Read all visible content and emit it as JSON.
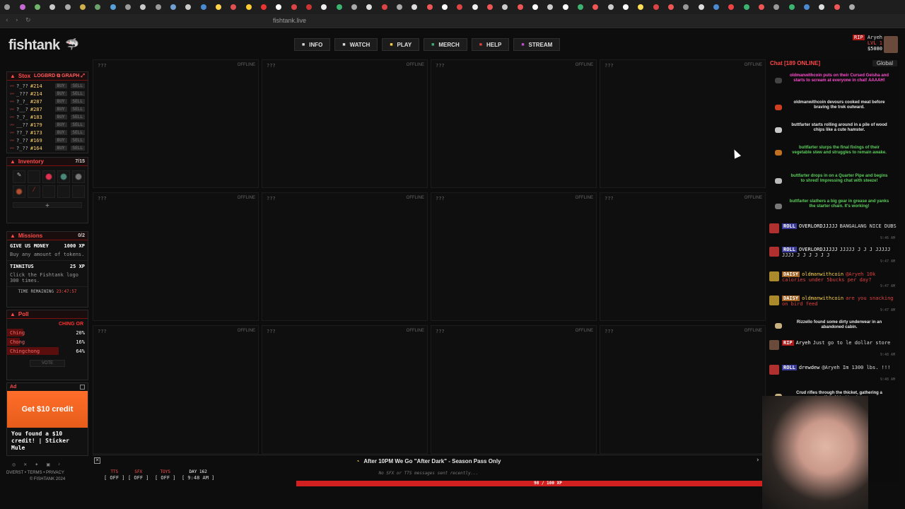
{
  "browser": {
    "url": "fishtank.live",
    "tab_colors": [
      "#9a9a9a",
      "#c36bd0",
      "#70b36b",
      "#c9c9c9",
      "#aaaaaa",
      "#d0b04a",
      "#6ea06b",
      "#57a0d6",
      "#9a9a9a",
      "#c9c9c9",
      "#999",
      "#70a0d0",
      "#c9c9c9",
      "#4a8ad0",
      "#ffd34a",
      "#e05050",
      "#ffcc33",
      "#e33",
      "#fff",
      "#d44",
      "#c33",
      "#eee",
      "#3cb371",
      "#aaa",
      "#ddd",
      "#d44",
      "#aaa",
      "#ddd",
      "#e55",
      "#fff",
      "#d44",
      "#eee",
      "#e55",
      "#ccc",
      "#e55",
      "#fff",
      "#ccc",
      "#fff",
      "#3cb371",
      "#e55",
      "#ccc",
      "#fff",
      "#ffdd55",
      "#d44",
      "#e55",
      "#999",
      "#ddd",
      "#4a8ad0",
      "#e44",
      "#3cb371",
      "#e55",
      "#999",
      "#3cb371",
      "#4a8ad0",
      "#ddd",
      "#e55",
      "#aaa"
    ]
  },
  "header": {
    "logo": "fishtank",
    "nav": [
      {
        "label": "INFO",
        "icon": "info-icon",
        "color": "#ddd"
      },
      {
        "label": "WATCH",
        "icon": "tv-icon",
        "color": "#ddd"
      },
      {
        "label": "PLAY",
        "icon": "grid-icon",
        "color": "#ffd34a"
      },
      {
        "label": "MERCH",
        "icon": "cart-icon",
        "color": "#3cb371"
      },
      {
        "label": "HELP",
        "icon": "help-icon",
        "color": "#e04040"
      },
      {
        "label": "STREAM",
        "icon": "stream-icon",
        "color": "#c050d0"
      }
    ],
    "user": {
      "badge": "RIP",
      "name": "Aryeh",
      "level": "LVL 1",
      "coins": "$5080"
    }
  },
  "stox": {
    "title": "Stox",
    "links": "LOGBRD ⧉ GRAPH ⤢",
    "rows": [
      {
        "name": "?_??",
        "price": "#214"
      },
      {
        "name": "_???",
        "price": "#214"
      },
      {
        "name": "?_?_",
        "price": "#287"
      },
      {
        "name": "?__?",
        "price": "#287"
      },
      {
        "name": "?_?_",
        "price": "#183"
      },
      {
        "name": "__??",
        "price": "#179"
      },
      {
        "name": "??_?",
        "price": "#173"
      },
      {
        "name": "?_??",
        "price": "#169"
      },
      {
        "name": "?_??",
        "price": "#164"
      }
    ],
    "buy": "BUY",
    "sell": "SELL"
  },
  "inventory": {
    "title": "Inventory",
    "count": "7/15",
    "add": "+"
  },
  "missions": {
    "title": "Missions",
    "count": "0/2",
    "items": [
      {
        "name": "GIVE US MONEY",
        "xp": "1000 XP",
        "desc": "Buy any amount of tokens."
      },
      {
        "name": "TINNITUS",
        "xp": "25 XP",
        "desc": "Click the Fishtank logo 300 times."
      }
    ],
    "timer_label": "TIME REMAINING",
    "timer": "23:47:57"
  },
  "poll": {
    "title": "Poll",
    "status": "CHING OR",
    "options": [
      {
        "label": "Ching",
        "pct": "20%"
      },
      {
        "label": "Chong",
        "pct": "16%"
      },
      {
        "label": "Chingchong",
        "pct": "64%"
      }
    ],
    "vote": "VOTE"
  },
  "ad": {
    "title": "Ad",
    "headline": "Get $10 credit",
    "body": "You found a $10 credit! | Sticker Mule"
  },
  "footer": {
    "links": "DVERST  •  TERMS  •  PRIVACY",
    "copy": "© FISHTANK 2024"
  },
  "cams": [
    {
      "name": "???",
      "status": "OFFLINE"
    },
    {
      "name": "???",
      "status": "OFFLINE"
    },
    {
      "name": "???",
      "status": "OFFLINE"
    },
    {
      "name": "???",
      "status": "OFFLINE"
    },
    {
      "name": "???",
      "status": "OFFLINE"
    },
    {
      "name": "???",
      "status": "OFFLINE"
    },
    {
      "name": "???",
      "status": "OFFLINE"
    },
    {
      "name": "???",
      "status": "OFFLINE"
    },
    {
      "name": "???",
      "status": "OFFLINE"
    },
    {
      "name": "???",
      "status": "OFFLINE"
    },
    {
      "name": "???",
      "status": "OFFLINE"
    },
    {
      "name": "???",
      "status": "OFFLINE"
    }
  ],
  "chat": {
    "title": "Chat [189 ONLINE]",
    "scope": "Global",
    "system": [
      {
        "text": "oldmanwithcoin puts on their Cursed Geisha and starts to scream at everyone in chat! AAAAH!",
        "color": "#ff4bd0"
      },
      {
        "text": "oldmanwithcoin devours cooked meat before braving the trek outward.",
        "color": "#eaeaea"
      },
      {
        "text": "buttfarter starts rolling around in a pile of wood chips like a cute hamster.",
        "color": "#eaeaea"
      },
      {
        "text": "buttfarter slurps the final fixings of their vegetable stew and struggles to remain awake.",
        "color": "#5bd05b"
      },
      {
        "text": "buttfarter drops in on a Quarter Pipe and begins to shred! Impressing chat with steeze!",
        "color": "#5bd05b"
      },
      {
        "text": "buttfarter slathers a big gear in grease and yanks the starter chain. It's working!",
        "color": "#5bd05b"
      }
    ],
    "messages": [
      {
        "badge": "ROLL",
        "user": "OVERLORDJJJJJ",
        "text": "BANGALANG NICE DUBS",
        "time": "9:46 AM"
      },
      {
        "badge": "ROLL",
        "user": "OVERLORDJJJJJ",
        "text": "JJJJJ J J J JJJJJ JJJJ J J J J J J",
        "time": "9:47 AM"
      },
      {
        "badge": "DAISY",
        "user": "oldmanwithcoin",
        "text": "@Aryeh 10k calories under 5bucks per day?",
        "time": "9:47 AM"
      },
      {
        "badge": "DAISY",
        "user": "oldmanwithcoin",
        "text": "are you snacking on bird feed",
        "time": "9:47 AM"
      },
      {
        "badge": "RIP",
        "user": "Aryeh",
        "text": "Just go to le dollar store",
        "time": "9:48 AM"
      },
      {
        "badge": "ROLL",
        "user": "drewdew",
        "text": "@Aryeh Im 1300 lbs. !!!",
        "time": "9:48 AM"
      }
    ],
    "system2": [
      {
        "text": "Rizzello found some dirty underwear in an abandoned cabin.",
        "color": "#eaeaea"
      },
      {
        "text": "Crud rifles through the thicket, gathering a handful of blackberries.",
        "color": "#eaeaea"
      }
    ]
  },
  "banner": "After 10PM We Go \"After Dark\" - Season Pass Only",
  "bottom": {
    "controls": [
      {
        "label": "TTS",
        "state": "[ OFF ]"
      },
      {
        "label": "SFX",
        "state": "[ OFF ]"
      },
      {
        "label": "TOYS",
        "state": "[ OFF ]"
      },
      {
        "label": "DAY 162",
        "state": "[ 9:48 AM ]"
      }
    ],
    "note": "No SFX or TTS messages sent recently...",
    "xp_text": "98 / 100 XP",
    "xp_fraction": 0.98
  }
}
